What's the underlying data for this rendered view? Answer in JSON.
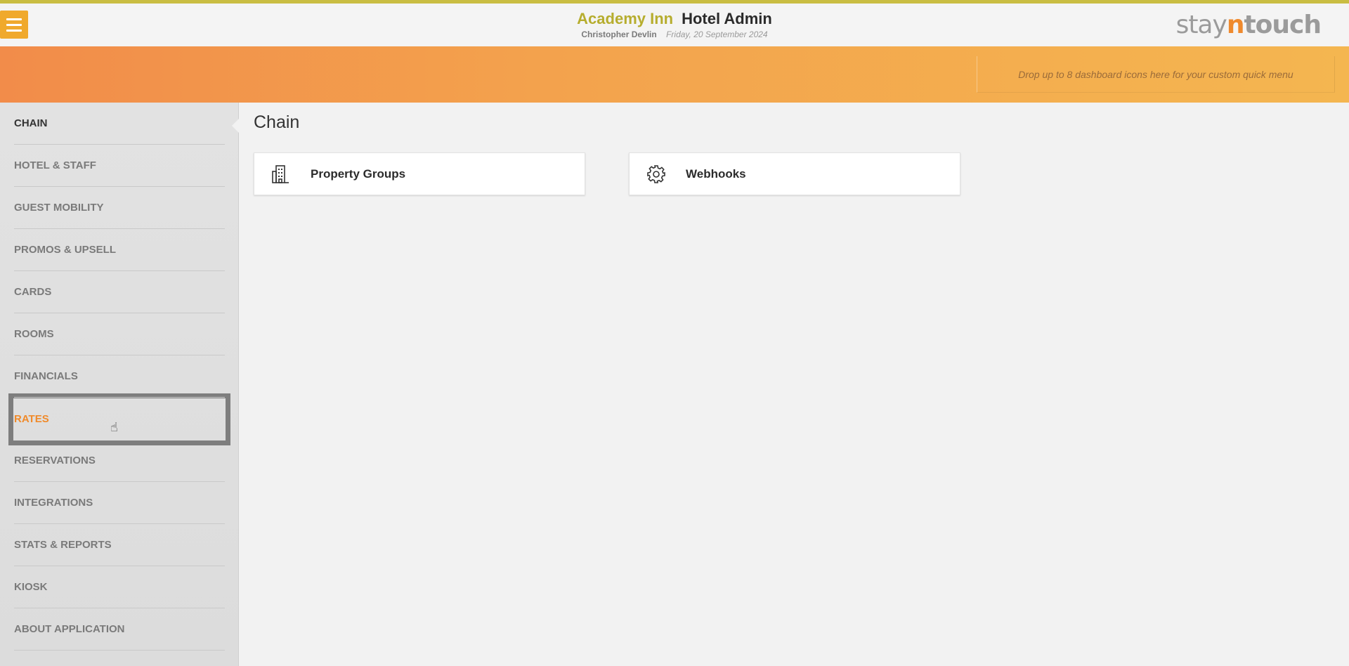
{
  "header": {
    "hotel_name": "Academy Inn",
    "app_name": "Hotel Admin",
    "user_name": "Christopher Devlin",
    "date": "Friday, 20 September 2024",
    "logo": {
      "part1": "stay",
      "part2": "n",
      "part3": "touch"
    },
    "menu_icon": "hamburger-icon"
  },
  "banner": {
    "dropzone_text": "Drop up to 8 dashboard icons here for your custom quick menu"
  },
  "sidebar": {
    "active_index": 0,
    "hover_index": 7,
    "items": [
      {
        "label": "CHAIN"
      },
      {
        "label": "HOTEL & STAFF"
      },
      {
        "label": "GUEST MOBILITY"
      },
      {
        "label": "PROMOS & UPSELL"
      },
      {
        "label": "CARDS"
      },
      {
        "label": "ROOMS"
      },
      {
        "label": "FINANCIALS"
      },
      {
        "label": "RATES"
      },
      {
        "label": "RESERVATIONS"
      },
      {
        "label": "INTEGRATIONS"
      },
      {
        "label": "STATS & REPORTS"
      },
      {
        "label": "KIOSK"
      },
      {
        "label": "ABOUT APPLICATION"
      }
    ]
  },
  "main": {
    "title": "Chain",
    "cards": [
      {
        "label": "Property Groups",
        "icon": "building-icon"
      },
      {
        "label": "Webhooks",
        "icon": "gear-icon"
      }
    ]
  },
  "colors": {
    "accent_orange": "#f08a2a",
    "hotel_name": "#b6ad2e",
    "top_border": "#c9bd42"
  }
}
